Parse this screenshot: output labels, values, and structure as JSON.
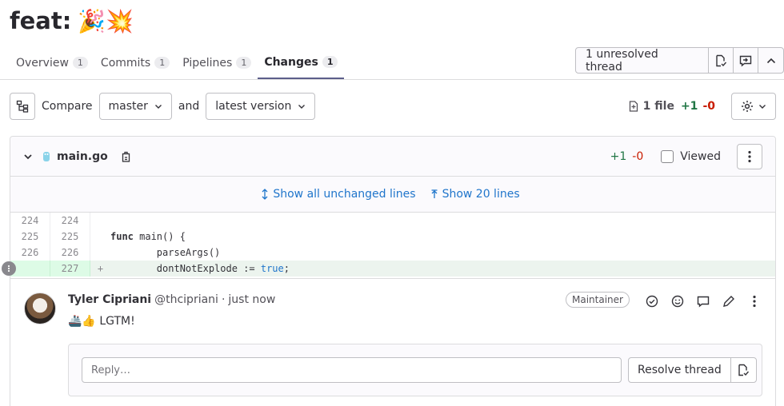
{
  "mr": {
    "title": "feat:",
    "title_emoji": "🎉💥"
  },
  "tabs": [
    {
      "label": "Overview",
      "count": "1"
    },
    {
      "label": "Commits",
      "count": "1"
    },
    {
      "label": "Pipelines",
      "count": "1"
    },
    {
      "label": "Changes",
      "count": "1",
      "active": true
    }
  ],
  "threads": {
    "label": "1 unresolved thread"
  },
  "compare": {
    "compare_label": "Compare",
    "base": "master",
    "and_label": "and",
    "head": "latest version",
    "files": "1 file",
    "additions": "+1",
    "deletions": "-0"
  },
  "file": {
    "name": "main.go",
    "additions": "+1",
    "deletions": "-0",
    "viewed_label": "Viewed",
    "show_all": "Show all unchanged lines",
    "show_20": "Show 20 lines"
  },
  "lines": [
    {
      "old": "224",
      "new": "224",
      "marker": "",
      "code": ""
    },
    {
      "old": "225",
      "new": "225",
      "marker": "",
      "kw": "func",
      "code": " main() {"
    },
    {
      "old": "226",
      "new": "226",
      "marker": "",
      "code": "        parseArgs()"
    },
    {
      "old": "",
      "new": "227",
      "marker": "+",
      "code": "        dontNotExplode := ",
      "lit": "true",
      "tail": ";"
    }
  ],
  "comment": {
    "author": "Tyler Cipriani",
    "handle": "@thcipriani",
    "sep": "·",
    "time": "just now",
    "role": "Maintainer",
    "emojis": "🚢👍",
    "body": "LGTM!",
    "reply_placeholder": "Reply…",
    "resolve_label": "Resolve thread"
  },
  "colors": {
    "accent": "#1f75cb",
    "added": "#217645",
    "removed": "#c91c00",
    "added_bg": "#ecf4ee"
  }
}
